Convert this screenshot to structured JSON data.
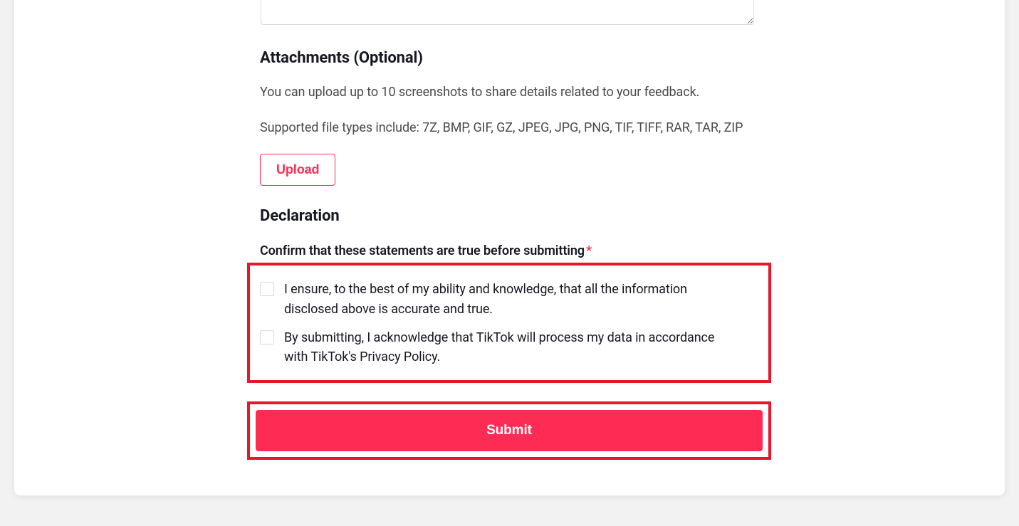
{
  "attachments": {
    "heading": "Attachments (Optional)",
    "desc": "You can upload up to 10 screenshots to share details related to your feedback.",
    "filetypes": "Supported file types include: 7Z, BMP, GIF, GZ, JPEG, JPG, PNG, TIF, TIFF, RAR, TAR, ZIP",
    "upload_label": "Upload"
  },
  "declaration": {
    "heading": "Declaration",
    "confirm_label": "Confirm that these statements are true before submitting",
    "required_mark": "*",
    "check1": "I ensure, to the best of my ability and knowledge, that all the information disclosed above is accurate and true.",
    "check2": "By submitting, I acknowledge that TikTok will process my data in accordance with TikTok's Privacy Policy."
  },
  "submit_label": "Submit"
}
